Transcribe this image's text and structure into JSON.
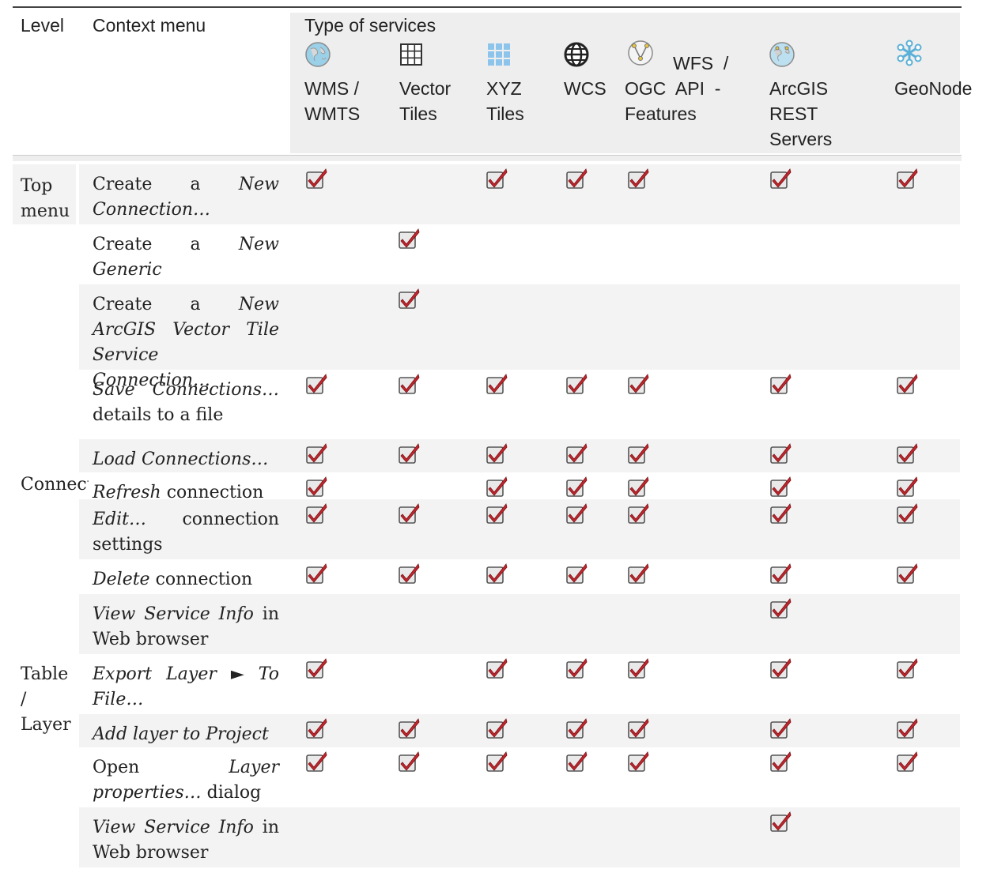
{
  "header": {
    "level": "Level",
    "context_menu": "Context menu",
    "type_of_services": "Type of services",
    "wms": [
      "WMS /",
      "WMTS"
    ],
    "vector_tiles": [
      "Vector",
      "Tiles"
    ],
    "xyz_tiles": [
      "XYZ",
      "Tiles"
    ],
    "wcs": "WCS",
    "wfs": [
      "WFS  /",
      "OGC  API  -",
      "Features"
    ],
    "arcgis": [
      "ArcGIS",
      "REST",
      "Servers"
    ],
    "geonode": "GeoNode"
  },
  "levels": {
    "top_menu": [
      "Top",
      "menu"
    ],
    "connection": "Connection",
    "table_layer": [
      "Table",
      "/",
      "Layer"
    ]
  },
  "rows": [
    {
      "parts": [
        [
          "Create a ",
          false
        ],
        [
          "New Connection…",
          true
        ]
      ],
      "checks": [
        1,
        0,
        1,
        1,
        1,
        1,
        1
      ]
    },
    {
      "parts": [
        [
          "Create a ",
          false
        ],
        [
          "New Generic Connection…",
          true
        ]
      ],
      "checks": [
        0,
        1,
        0,
        0,
        0,
        0,
        0
      ]
    },
    {
      "parts": [
        [
          "Create a ",
          false
        ],
        [
          "New ArcGIS Vector Tile Service Connection…",
          true
        ]
      ],
      "checks": [
        0,
        1,
        0,
        0,
        0,
        0,
        0
      ]
    },
    {
      "parts": [
        [
          "Save Connections…",
          true
        ],
        [
          " details to a file",
          false
        ]
      ],
      "checks": [
        1,
        1,
        1,
        1,
        1,
        1,
        1
      ]
    },
    {
      "parts": [
        [
          "Load Connections…",
          true
        ]
      ],
      "checks": [
        1,
        1,
        1,
        1,
        1,
        1,
        1
      ]
    },
    {
      "parts": [
        [
          "Refresh",
          true
        ],
        [
          " connection",
          false
        ]
      ],
      "checks": [
        1,
        0,
        1,
        1,
        1,
        1,
        1
      ]
    },
    {
      "parts": [
        [
          "Edit…",
          true
        ],
        [
          " connection settings",
          false
        ]
      ],
      "checks": [
        1,
        1,
        1,
        1,
        1,
        1,
        1
      ]
    },
    {
      "parts": [
        [
          "Delete",
          true
        ],
        [
          " connection",
          false
        ]
      ],
      "checks": [
        1,
        1,
        1,
        1,
        1,
        1,
        1
      ]
    },
    {
      "parts": [
        [
          "View Service Info",
          true
        ],
        [
          " in Web browser",
          false
        ]
      ],
      "checks": [
        0,
        0,
        0,
        0,
        0,
        1,
        0
      ]
    },
    {
      "parts": [
        [
          "Export Layer ► To File…",
          true
        ]
      ],
      "checks": [
        1,
        0,
        1,
        1,
        1,
        1,
        1
      ]
    },
    {
      "parts": [
        [
          "Add layer to Project",
          true
        ]
      ],
      "checks": [
        1,
        1,
        1,
        1,
        1,
        1,
        1
      ]
    },
    {
      "parts": [
        [
          "Open ",
          false
        ],
        [
          "Layer properties…",
          true
        ],
        [
          " dialog",
          false
        ]
      ],
      "checks": [
        1,
        1,
        1,
        1,
        1,
        1,
        1
      ]
    },
    {
      "parts": [
        [
          "View Service Info",
          true
        ],
        [
          " in Web browser",
          false
        ]
      ],
      "checks": [
        0,
        0,
        0,
        0,
        0,
        1,
        0
      ]
    }
  ],
  "icons": {
    "wms": "globe-wms-icon",
    "vector_tiles": "grid-icon",
    "xyz_tiles": "tiles-icon",
    "wcs": "globe-wcs-icon",
    "wfs": "globe-wfs-icon",
    "arcgis": "globe-arcgis-icon",
    "geonode": "geonode-icon",
    "check": "checkbox-checked-icon"
  },
  "colors": {
    "check_mark": "#c0272d",
    "row_shade": "#f3f3f3",
    "header_bg": "#eeeeee"
  }
}
